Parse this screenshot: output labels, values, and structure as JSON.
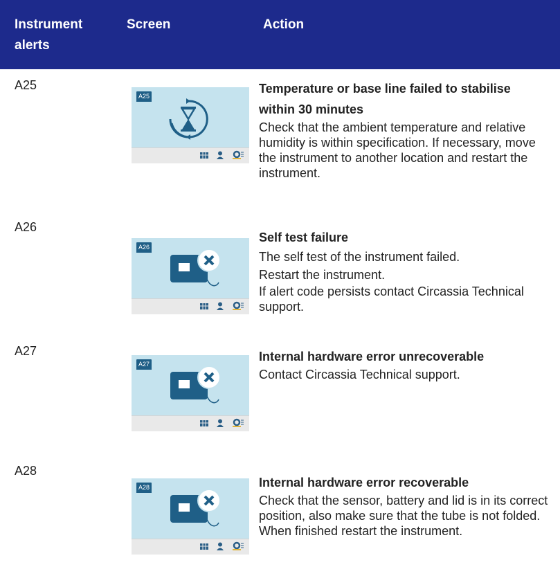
{
  "header": {
    "col1": "Instrument alerts",
    "col2": "Screen",
    "col3": "Action"
  },
  "rows": [
    {
      "code": "A25",
      "screen_code": "A25",
      "icon": "hourglass-icon",
      "title": "Temperature or base line failed to stabilise within 30 minutes",
      "lines": [
        "Check that the ambient temperature and relative humidity is within specification. If necessary, move the instrument to another location and restart the instrument."
      ]
    },
    {
      "code": "A26",
      "screen_code": "A26",
      "icon": "device-error-icon",
      "title": "Self test failure",
      "lines": [
        "The self test of the instrument failed.",
        "Restart the instrument.",
        "If alert code persists contact Circassia Technical support."
      ]
    },
    {
      "code": "A27",
      "screen_code": "A27",
      "icon": "device-error-icon",
      "title": "Internal hardware error unrecoverable",
      "lines": [
        "Contact Circassia Technical support."
      ]
    },
    {
      "code": "A28",
      "screen_code": "A28",
      "icon": "device-error-icon",
      "title": "Internal hardware error recoverable",
      "lines": [
        "Check that the sensor, battery and lid is in its correct position, also make sure that the tube is not folded. When finished restart the instrument."
      ]
    }
  ],
  "colors": {
    "header_bg": "#1d2a8c",
    "screen_bg": "#c5e3ee",
    "icon_dark": "#1f5f87"
  }
}
